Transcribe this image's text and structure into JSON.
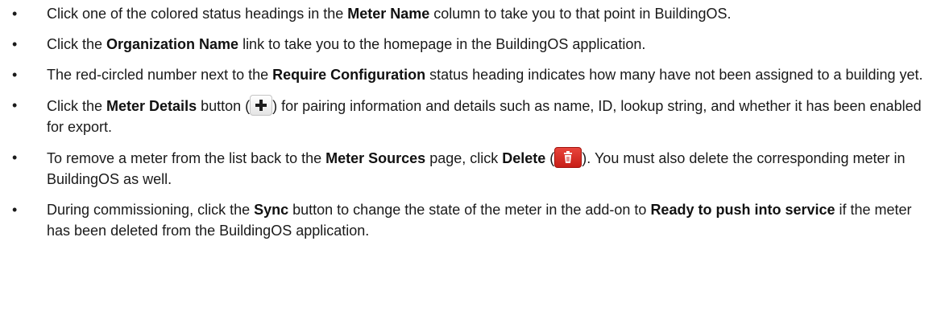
{
  "bullets": [
    {
      "t1": "Click one of the colored status headings in the ",
      "b1": "Meter Name",
      "t2": " column to take you to that point in BuildingOS."
    },
    {
      "t1": "Click the ",
      "b1": "Organization Name",
      "t2": " link to take you to the homepage in the BuildingOS application."
    },
    {
      "t1": "The red-circled number next to the ",
      "b1": "Require Configuration",
      "t2": " status heading indicates how many have not been assigned to a building yet."
    },
    {
      "t1": "Click the ",
      "b1": "Meter Details",
      "t2": " button (",
      "icon": "plus-icon",
      "t3": ") for pairing information and details such as name, ID, lookup string, and whether it has been enabled for export."
    },
    {
      "t1": "To remove a meter from the list back to the ",
      "b1": "Meter Sources",
      "t2": " page, click ",
      "b2": "Delete",
      "t3": " (",
      "icon": "trash-icon",
      "t4": "). You must also delete the corresponding meter in BuildingOS as well."
    },
    {
      "t1": "During commissioning, click the ",
      "b1": "Sync",
      "t2": " button to change the state of the meter in the add-on to ",
      "b2": "Ready to push into service",
      "t3": " if the meter has been deleted from the BuildingOS application."
    }
  ],
  "bullet_glyph": "•",
  "colors": {
    "text": "#1a1a1a",
    "delete_button": "#d42b22"
  }
}
